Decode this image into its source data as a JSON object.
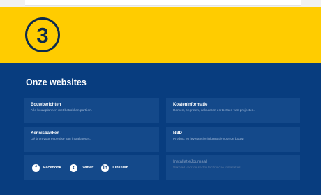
{
  "step": {
    "number": "3"
  },
  "websites": {
    "title": "Onze websites",
    "cards": [
      {
        "title": "Bouwberichten",
        "desc": "Alle bouwplannen met betrokken partijen."
      },
      {
        "title": "Kostеninformatie",
        "desc": "Ramen, begroten, calculeren en toetsen van projecten."
      },
      {
        "title": "Kennisbanken",
        "desc": "Dé bron voor expertise van installateurs."
      },
      {
        "title": "NBD",
        "desc": "Product en leverancier informatie voor de bouw."
      },
      {
        "title": "InstallatieJournaal",
        "desc": "Vakblad voor de sector technische installaties."
      }
    ],
    "social": [
      {
        "label": "Facebook",
        "icon": "facebook-icon",
        "glyph": "f"
      },
      {
        "label": "Twitter",
        "icon": "twitter-icon",
        "glyph": "t"
      },
      {
        "label": "LinkedIn",
        "icon": "linkedin-icon",
        "glyph": "in"
      }
    ]
  },
  "colors": {
    "yellow": "#ffcc00",
    "navy": "#083d7f",
    "card": "#14498a",
    "badge": "#0c2a4e"
  }
}
